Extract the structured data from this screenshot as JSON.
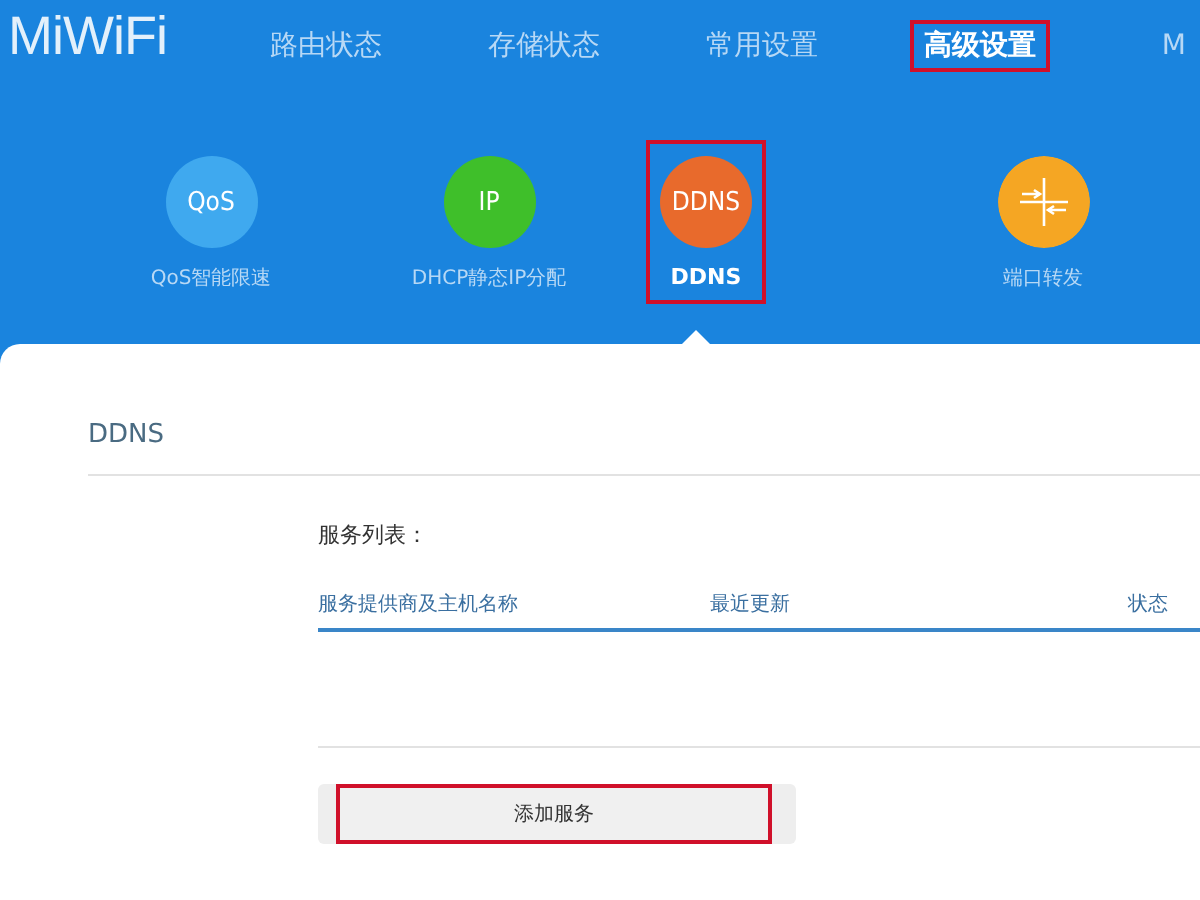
{
  "logo": "MiWiFi",
  "nav": [
    {
      "label": "路由状态",
      "selected": false,
      "highlighted": false
    },
    {
      "label": "存储状态",
      "selected": false,
      "highlighted": false
    },
    {
      "label": "常用设置",
      "selected": false,
      "highlighted": false
    },
    {
      "label": "高级设置",
      "selected": true,
      "highlighted": true
    },
    {
      "label": "M",
      "selected": false,
      "highlighted": false
    }
  ],
  "features": [
    {
      "kind": "text",
      "icon_text": "QoS",
      "color": "#3fa9ef",
      "label": "QoS智能限速",
      "selected": false,
      "highlighted": false
    },
    {
      "kind": "text",
      "icon_text": "IP",
      "color": "#3fbf2a",
      "label": "DHCP静态IP分配",
      "selected": false,
      "highlighted": false
    },
    {
      "kind": "text",
      "icon_text": "DDNS",
      "color": "#e86a2c",
      "label": "DDNS",
      "selected": true,
      "highlighted": true
    },
    {
      "kind": "ports",
      "color": "#f5a623",
      "label": "端口转发",
      "selected": false,
      "highlighted": false
    }
  ],
  "section_title": "DDNS",
  "list_label": "服务列表：",
  "table": {
    "columns": [
      "服务提供商及主机名称",
      "最近更新",
      "状态"
    ]
  },
  "add_button": {
    "label": "添加服务",
    "highlighted": true
  }
}
